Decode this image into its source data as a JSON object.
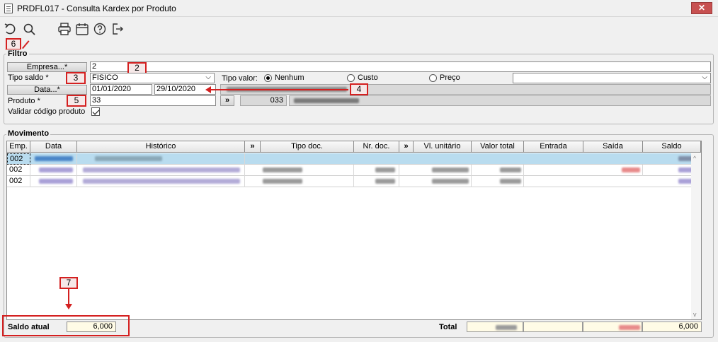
{
  "window": {
    "title": "PRDFL017 - Consulta Kardex por Produto",
    "close_label": "✕"
  },
  "toolbar": {
    "icons": [
      "undo-icon",
      "search-icon",
      "print-icon",
      "calendar-icon",
      "help-icon",
      "exit-icon"
    ]
  },
  "markers": {
    "m2": "2",
    "m3": "3",
    "m4": "4",
    "m5": "5",
    "m6": "6",
    "m7": "7"
  },
  "filter": {
    "legend": "Filtro",
    "empresa_label": "Empresa...*",
    "empresa_value": "2",
    "tipo_saldo_label": "Tipo saldo *",
    "tipo_saldo_value": "FISICO",
    "tipo_valor_label": "Tipo valor:",
    "tipo_valor_options": [
      "Nenhum",
      "Custo",
      "Preço"
    ],
    "data_label": "Data...*",
    "data_from": "01/01/2020",
    "data_to": "29/10/2020",
    "produto_label": "Produto *",
    "produto_value": "33",
    "produto_btn": "»",
    "produto_code": "033",
    "validar_label": "Validar código produto"
  },
  "movimento": {
    "legend": "Movimento",
    "columns": [
      "Emp.",
      "Data",
      "Histórico",
      "»",
      "Tipo doc.",
      "Nr. doc.",
      "»",
      "Vl. unitário",
      "Valor total",
      "Entrada",
      "Saída",
      "Saldo"
    ],
    "rows": [
      {
        "emp": "002"
      },
      {
        "emp": "002"
      },
      {
        "emp": "002"
      }
    ]
  },
  "footer": {
    "saldo_label": "Saldo atual",
    "saldo_value": "6,000",
    "total_label": "Total",
    "total_saldo": "6,000"
  },
  "colors": {
    "marker_red": "#d42020",
    "selection": "#b9dcef",
    "total_bg": "#fffbe6"
  }
}
